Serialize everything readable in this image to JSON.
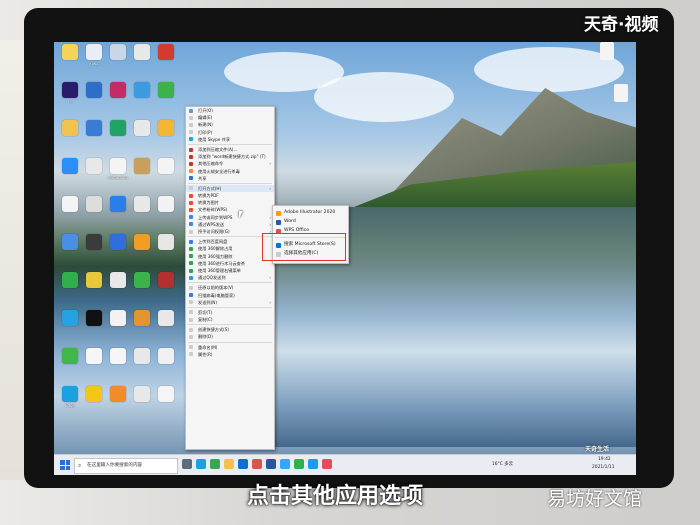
{
  "overlay": {
    "logo": "天奇·视频",
    "caption": "点击其他应用选项",
    "watermark": "易坊好文馆",
    "small_mark": "天奇生活"
  },
  "desktop_icons": [
    {
      "label": "",
      "color": "#f6d35a"
    },
    {
      "label": "kiwa",
      "color": "#e9eef6"
    },
    {
      "label": "",
      "color": "#c9d6e8"
    },
    {
      "label": "",
      "color": "#e8e8e8"
    },
    {
      "label": "",
      "color": "#d33b2d"
    },
    {
      "label": "Pr",
      "color": "#2a1b6b"
    },
    {
      "label": "",
      "color": "#2e6ec7"
    },
    {
      "label": "",
      "color": "#c52a65"
    },
    {
      "label": "",
      "color": "#3b9be0"
    },
    {
      "label": "",
      "color": "#3bb34a"
    },
    {
      "label": "",
      "color": "#f0c44c"
    },
    {
      "label": "",
      "color": "#3a7bd5"
    },
    {
      "label": "",
      "color": "#21a366"
    },
    {
      "label": "",
      "color": "#e8e8e8"
    },
    {
      "label": "",
      "color": "#f2b632"
    },
    {
      "label": "",
      "color": "#2c8ef8"
    },
    {
      "label": "",
      "color": "#e8e8e8"
    },
    {
      "label": "debug.log",
      "color": "#f4f4f4"
    },
    {
      "label": "",
      "color": "#c8a05c"
    },
    {
      "label": "",
      "color": "#f4f4f4"
    },
    {
      "label": "",
      "color": "#f4f4f4"
    },
    {
      "label": "",
      "color": "#dcdcdc"
    },
    {
      "label": "",
      "color": "#2b7de9"
    },
    {
      "label": "",
      "color": "#e8e8e8"
    },
    {
      "label": "",
      "color": "#f2f2f2"
    },
    {
      "label": "",
      "color": "#4a90e2"
    },
    {
      "label": "",
      "color": "#3b3b3b"
    },
    {
      "label": "",
      "color": "#2f6fdb"
    },
    {
      "label": "",
      "color": "#f59c23"
    },
    {
      "label": "",
      "color": "#e6e6e6"
    },
    {
      "label": "",
      "color": "#2fb04c"
    },
    {
      "label": "",
      "color": "#e8c73b"
    },
    {
      "label": "",
      "color": "#e8e8e8"
    },
    {
      "label": "",
      "color": "#3bb34a"
    },
    {
      "label": "",
      "color": "#b33030"
    },
    {
      "label": "",
      "color": "#27a2e0"
    },
    {
      "label": "",
      "color": "#111111"
    },
    {
      "label": "",
      "color": "#f2f2f2"
    },
    {
      "label": "",
      "color": "#e2962e"
    },
    {
      "label": "",
      "color": "#e8e8e8"
    },
    {
      "label": "",
      "color": "#3fb74a"
    },
    {
      "label": "",
      "color": "#f5f5f5"
    },
    {
      "label": "",
      "color": "#f5f5f5"
    },
    {
      "label": "",
      "color": "#e8e8e8"
    },
    {
      "label": "",
      "color": "#f0f0f0"
    },
    {
      "label": "Edge",
      "color": "#1ba1e2"
    },
    {
      "label": "",
      "color": "#f5c518"
    },
    {
      "label": "",
      "color": "#f28c28"
    },
    {
      "label": "",
      "color": "#e8e8e8"
    },
    {
      "label": "",
      "color": "#f5f5f5"
    }
  ],
  "context_menu": {
    "items": [
      {
        "label": "打开(O)",
        "color": "#5b9bd5",
        "arrow": ""
      },
      {
        "label": "编辑(E)",
        "color": "#cccccc",
        "arrow": ""
      },
      {
        "label": "新建(N)",
        "color": "#cccccc",
        "arrow": ""
      },
      {
        "label": "打印(P)",
        "color": "#cccccc",
        "arrow": ""
      },
      {
        "label": "使用 Skype 共享",
        "color": "#00aff0",
        "arrow": ""
      },
      {
        "label": "添加到压缩文件(A)...",
        "color": "#c0392b",
        "arrow": ""
      },
      {
        "label": "添加到 \"word新建快捷方式.zip\" (T)",
        "color": "#c0392b",
        "arrow": ""
      },
      {
        "label": "其他压缩命令",
        "color": "#c0392b",
        "arrow": ">"
      },
      {
        "label": "使用火绒安全进行杀毒",
        "color": "#f08a24",
        "arrow": ""
      },
      {
        "label": "共享",
        "color": "#2a6fd1",
        "arrow": ""
      },
      {
        "label": "打开方式(H)",
        "color": "#cccccc",
        "arrow": ">"
      },
      {
        "label": "转换为PDF",
        "color": "#e74c3c",
        "arrow": ""
      },
      {
        "label": "转换为图片",
        "color": "#e74c3c",
        "arrow": ""
      },
      {
        "label": "文件粉碎(WPS)",
        "color": "#e74c3c",
        "arrow": ""
      },
      {
        "label": "上传或同步到WPS",
        "color": "#3b82f6",
        "arrow": ">"
      },
      {
        "label": "通过WPS发送",
        "color": "#3b82f6",
        "arrow": ">"
      },
      {
        "label": "授予访问权限(G)",
        "color": "#cccccc",
        "arrow": ">"
      },
      {
        "label": "上传到百度网盘",
        "color": "#2f80ed",
        "arrow": ""
      },
      {
        "label": "使用 360解除占用",
        "color": "#2ea44f",
        "arrow": ""
      },
      {
        "label": "使用 360强力删除",
        "color": "#2ea44f",
        "arrow": ""
      },
      {
        "label": "使用 360进行木马云查杀",
        "color": "#2ea44f",
        "arrow": ""
      },
      {
        "label": "使用 360管理右键菜单",
        "color": "#2ea44f",
        "arrow": ""
      },
      {
        "label": "通过QQ发送到",
        "color": "#1d9bf0",
        "arrow": ">"
      },
      {
        "label": "还原以前的版本(V)",
        "color": "#cccccc",
        "arrow": ""
      },
      {
        "label": "扫描病毒(电脑管家)",
        "color": "#2f80ed",
        "arrow": ""
      },
      {
        "label": "发送到(N)",
        "color": "#cccccc",
        "arrow": ">"
      },
      {
        "label": "剪切(T)",
        "color": "#cccccc",
        "arrow": ""
      },
      {
        "label": "复制(C)",
        "color": "#cccccc",
        "arrow": ""
      },
      {
        "label": "创建快捷方式(S)",
        "color": "#cccccc",
        "arrow": ""
      },
      {
        "label": "删除(D)",
        "color": "#cccccc",
        "arrow": ""
      },
      {
        "label": "重命名(M)",
        "color": "#cccccc",
        "arrow": ""
      },
      {
        "label": "属性(R)",
        "color": "#cccccc",
        "arrow": ""
      }
    ]
  },
  "open_with_submenu": {
    "items": [
      {
        "label": "Adobe Illustrator 2020",
        "color": "#ff9a00"
      },
      {
        "label": "Word",
        "color": "#2b579a"
      },
      {
        "label": "WPS Office",
        "color": "#d9534f"
      },
      {
        "label": "搜索 Microsoft Store(S)",
        "color": "#0078d4"
      },
      {
        "label": "选择其他应用(C)",
        "color": "#cccccc"
      }
    ]
  },
  "taskbar": {
    "start_color": "#2b6fd6",
    "search_placeholder": "在这里输入你要搜索的内容",
    "search_icon": "search-icon",
    "apps": [
      {
        "name": "task-view-icon",
        "color": "#5f6b7a"
      },
      {
        "name": "edge-icon",
        "color": "#1ba1e2"
      },
      {
        "name": "chrome-icon",
        "color": "#34a853"
      },
      {
        "name": "folder-icon",
        "color": "#f2c14e"
      },
      {
        "name": "store-icon",
        "color": "#0f6fd1"
      },
      {
        "name": "wps-icon",
        "color": "#d9534f"
      },
      {
        "name": "word-icon",
        "color": "#2b579a"
      },
      {
        "name": "ps-icon",
        "color": "#31a8ff"
      },
      {
        "name": "wechat-icon",
        "color": "#2fb04c"
      },
      {
        "name": "qq-icon",
        "color": "#1d9bf0"
      },
      {
        "name": "music-icon",
        "color": "#e84a5f"
      }
    ],
    "tray_weather": "16°C 多云",
    "tray_time": "19:42",
    "tray_date": "2021/1/11"
  }
}
